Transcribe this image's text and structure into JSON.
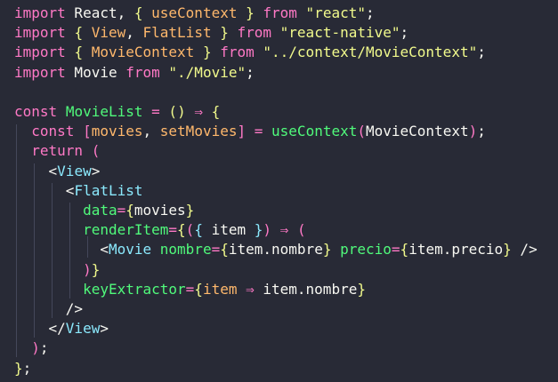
{
  "lines": [
    [
      "import",
      " React, ",
      "{",
      " ",
      "useContext",
      " ",
      "}",
      " from ",
      "\"react\"",
      ";"
    ],
    [
      "import",
      " ",
      "{",
      " ",
      "View",
      ", ",
      "FlatList",
      " ",
      "}",
      " from ",
      "\"react-native\"",
      ";"
    ],
    [
      "import",
      " ",
      "{",
      " ",
      "MovieContext",
      " ",
      "}",
      " from ",
      "\"../context/MovieContext\"",
      ";"
    ],
    [
      "import",
      " Movie ",
      "from",
      " ",
      "\"./Movie\"",
      ";"
    ],
    [],
    [
      "const",
      " ",
      "MovieList",
      " = ",
      "(",
      ")",
      " ⇒ ",
      "{"
    ],
    [
      "  ",
      "const",
      " ",
      "[",
      "movies",
      ", ",
      "setMovies",
      "]",
      " = ",
      "useContext",
      "(",
      "MovieContext",
      ")",
      ";"
    ],
    [
      "  ",
      "return",
      " ",
      "("
    ],
    [
      "    ",
      "<",
      "View",
      ">"
    ],
    [
      "      ",
      "<",
      "FlatList"
    ],
    [
      "        ",
      "data",
      "=",
      "{",
      "movies",
      "}"
    ],
    [
      "        ",
      "renderItem",
      "=",
      "{",
      "(",
      "{",
      " item ",
      "}",
      ")",
      " ⇒ ",
      "("
    ],
    [
      "          ",
      "<",
      "Movie",
      " nombre",
      "=",
      "{",
      "item.nombre",
      "}",
      " precio",
      "=",
      "{",
      "item.precio",
      "}",
      " />"
    ],
    [
      "        ",
      ")",
      "}"
    ],
    [
      "        ",
      "keyExtractor",
      "=",
      "{",
      "item",
      " ⇒ ",
      "item.nombre",
      "}"
    ],
    [
      "      ",
      "/>"
    ],
    [
      "    ",
      "</",
      "View",
      ">"
    ],
    [
      "  ",
      ")",
      ";"
    ],
    [
      "}",
      ";"
    ]
  ]
}
